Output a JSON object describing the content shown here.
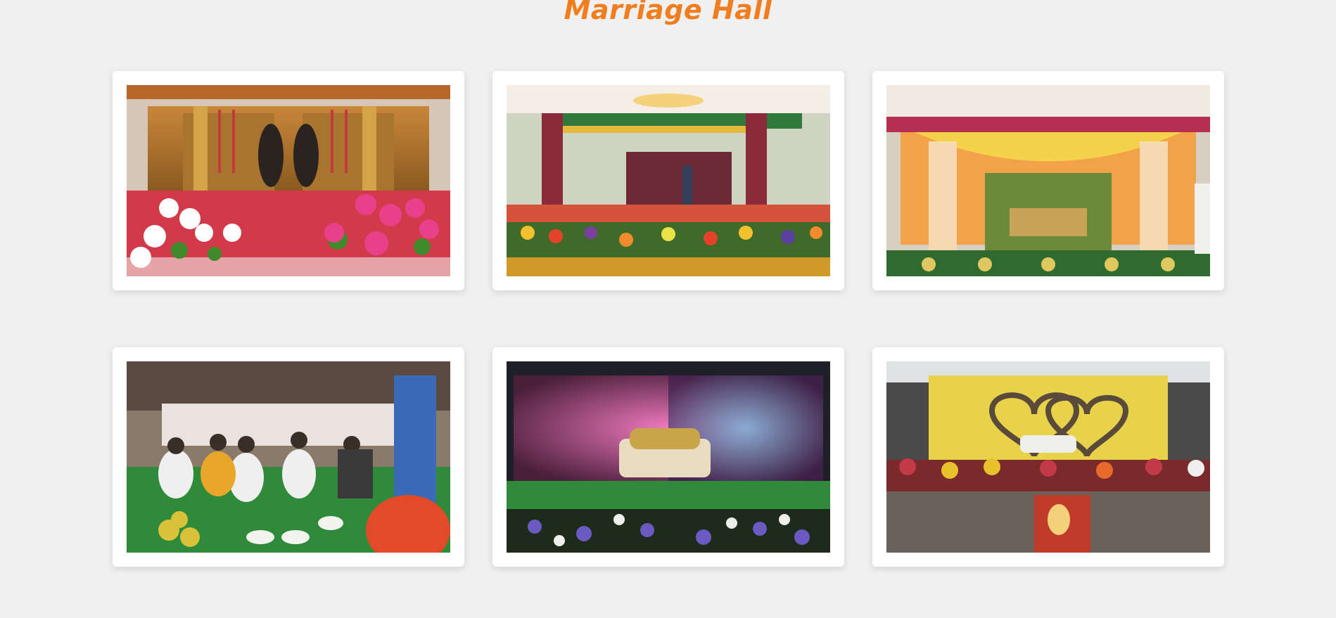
{
  "page": {
    "title": "Marriage Hall",
    "accent_color": "#f07d1e",
    "background_color": "#f0f0f0"
  },
  "gallery": {
    "items": [
      {
        "icon": "wedding-stage-photo"
      },
      {
        "icon": "floral-arch-photo"
      },
      {
        "icon": "decorated-stage-photo"
      },
      {
        "icon": "ceremony-guests-photo"
      },
      {
        "icon": "flower-wall-photo"
      },
      {
        "icon": "heart-stage-photo"
      }
    ]
  }
}
